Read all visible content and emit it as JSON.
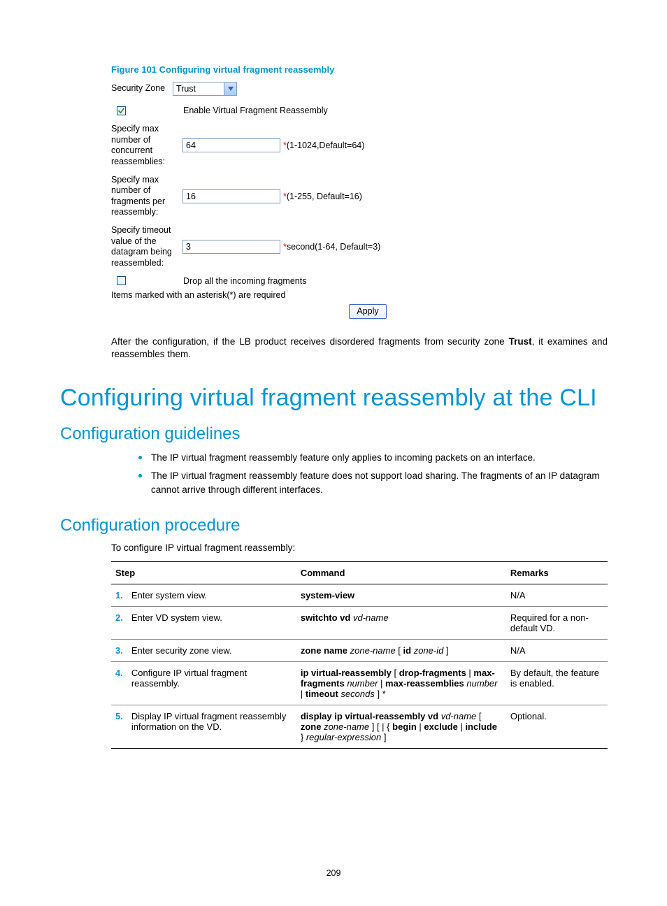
{
  "figure_caption": "Figure 101 Configuring virtual fragment reassembly",
  "shot": {
    "zone_label": "Security Zone",
    "zone_value": "Trust",
    "enable_checked": true,
    "enable_label": "Enable Virtual Fragment Reassembly",
    "row1_label": "Specify max number of concurrent reassemblies:",
    "row1_value": "64",
    "row1_hint": "(1-1024,Default=64)",
    "row2_label": "Specify max number of fragments per reassembly:",
    "row2_value": "16",
    "row2_hint": "(1-255, Default=16)",
    "row3_label": "Specify timeout value of the datagram being reassembled:",
    "row3_value": "3",
    "row3_hint": "second(1-64, Default=3)",
    "drop_checked": false,
    "drop_label": "Drop all the incoming fragments",
    "req_note": "Items marked with an asterisk(*) are required",
    "apply_label": "Apply"
  },
  "after_text_pre": "After the configuration, if the LB product receives disordered fragments from security zone ",
  "after_text_bold": "Trust",
  "after_text_post": ", it examines and reassembles them.",
  "h_main": "Configuring virtual fragment reassembly at the CLI",
  "h_guidelines": "Configuration guidelines",
  "guideline1": "The IP virtual fragment reassembly feature only applies to incoming packets on an interface.",
  "guideline2": "The IP virtual fragment reassembly feature does not support load sharing. The fragments of an IP datagram cannot arrive through different interfaces.",
  "h_procedure": "Configuration procedure",
  "proc_lead": "To configure IP virtual fragment reassembly:",
  "tbl": {
    "h_step": "Step",
    "h_cmd": "Command",
    "h_rem": "Remarks",
    "r1_n": "1.",
    "r1_s": "Enter system view.",
    "r1_c_b": "system-view",
    "r1_r": "N/A",
    "r2_n": "2.",
    "r2_s": "Enter VD system view.",
    "r2_c_b": "switchto vd",
    "r2_c_i": " vd-name",
    "r2_r": "Required for a non-default VD.",
    "r3_n": "3.",
    "r3_s": "Enter security zone view.",
    "r3_c_b1": "zone name",
    "r3_c_i1": " zone-name ",
    "r3_c_t1": "[ ",
    "r3_c_b2": "id",
    "r3_c_i2": " zone-id ",
    "r3_c_t2": "]",
    "r3_r": "N/A",
    "r4_n": "4.",
    "r4_s": "Configure IP virtual fragment reassembly.",
    "r4_c_b1": "ip virtual-reassembly",
    "r4_c_t1": " [ ",
    "r4_c_b2": "drop-fragments",
    "r4_c_t2": " | ",
    "r4_c_b3": "max-fragments",
    "r4_c_i1": " number ",
    "r4_c_t3": "| ",
    "r4_c_b4": "max-reassemblies",
    "r4_c_i2": " number ",
    "r4_c_t4": "| ",
    "r4_c_b5": "timeout",
    "r4_c_i3": " seconds ",
    "r4_c_t5": "] *",
    "r4_r": "By default, the feature is enabled.",
    "r5_n": "5.",
    "r5_s": "Display IP virtual fragment reassembly information on the VD.",
    "r5_c_b1": "display ip virtual-reassembly vd",
    "r5_c_i1": " vd-name ",
    "r5_c_t1": "[ ",
    "r5_c_b2": "zone",
    "r5_c_i2": " zone-name ",
    "r5_c_t2": "] [ | { ",
    "r5_c_b3": "begin",
    "r5_c_t3": " | ",
    "r5_c_b4": "exclude",
    "r5_c_t4": " | ",
    "r5_c_b5": "include",
    "r5_c_t5": " } ",
    "r5_c_i3": "regular-expression ",
    "r5_c_t6": "]",
    "r5_r": "Optional."
  },
  "page_number": "209"
}
